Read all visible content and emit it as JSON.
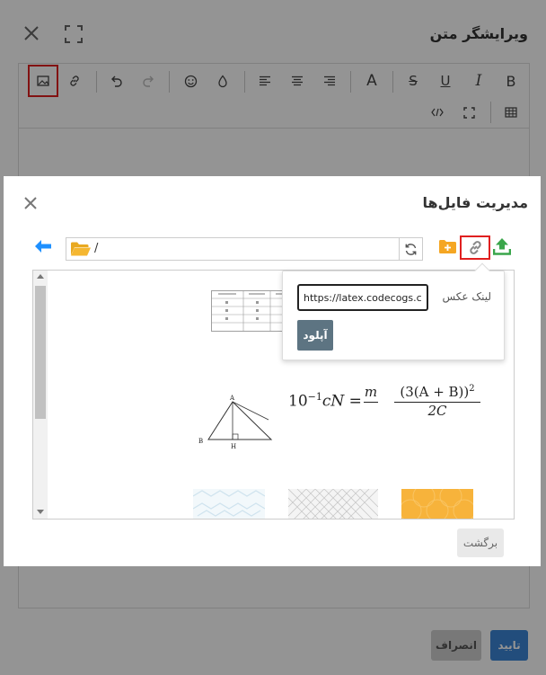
{
  "editor": {
    "title": "ویرایشگر متن",
    "toolbar": {
      "bold_label": "B",
      "italic_label": "I",
      "underline_label": "U",
      "strike_label": "S",
      "fontsize_label": "A"
    },
    "confirm_label": "تایید",
    "cancel_label": "انصراف"
  },
  "file_manager": {
    "title": "مدیریت فایل‌ها",
    "path": "/",
    "back_label": "برگشت",
    "link_popover": {
      "label": "لینک عکس",
      "url_value": "https://latex.codecogs.com",
      "upload_label": "آپلود"
    },
    "formula": {
      "left_base": "10",
      "left_exp": "−1",
      "left_rest": "cN =",
      "frac_num": "m",
      "frac_den": "",
      "right_num": "(3(A + B))",
      "right_exp": "2",
      "right_den": "2C"
    },
    "triangle_labels": {
      "a": "A",
      "b": "B",
      "h": "H"
    }
  },
  "colors": {
    "accent": "#3c86d6",
    "highlight": "#e02020",
    "folder": "#f5b731",
    "upload": "#3aa64b",
    "back_arrow": "#1e90ff"
  }
}
